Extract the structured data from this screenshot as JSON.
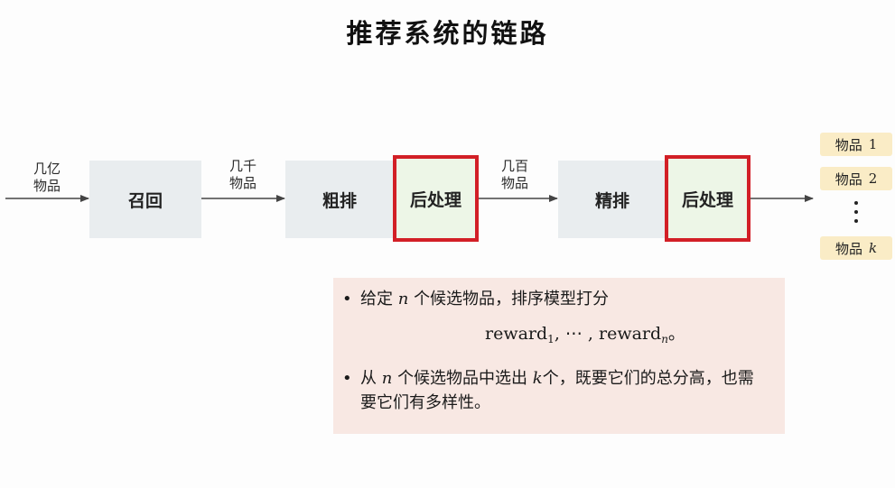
{
  "title": "推荐系统的链路",
  "flow": {
    "input_label": [
      "几亿",
      "物品"
    ],
    "after_recall_label": [
      "几千",
      "物品"
    ],
    "after_coarse_label": [
      "几百",
      "物品"
    ]
  },
  "stages": {
    "recall": "召回",
    "coarse_rank": "粗排",
    "post_process_1": "后处理",
    "fine_rank": "精排",
    "post_process_2": "后处理"
  },
  "outputs": {
    "item_label": "物品",
    "items": [
      "1",
      "2",
      "k"
    ]
  },
  "note": {
    "bullet1": {
      "prefix": "给定",
      "var": "n",
      "suffix": "个候选物品，排序模型打分",
      "reward_word": "reward",
      "sub_first": "1",
      "ellipsis": ", ⋯ , ",
      "sub_last": "n",
      "end": "。"
    },
    "bullet2": {
      "prefix": "从",
      "var_n": "n",
      "middle": "个候选物品中选出",
      "var_k": "k",
      "suffix": "个，既要它们的总分高，也需要它们有多样性。"
    }
  },
  "colors": {
    "stage_fill": "#e9edef",
    "post_fill": "#edf6e7",
    "post_border": "#d21f26",
    "item_fill": "#faecc6",
    "note_fill": "#f8e8e3",
    "arrow": "#444444"
  }
}
